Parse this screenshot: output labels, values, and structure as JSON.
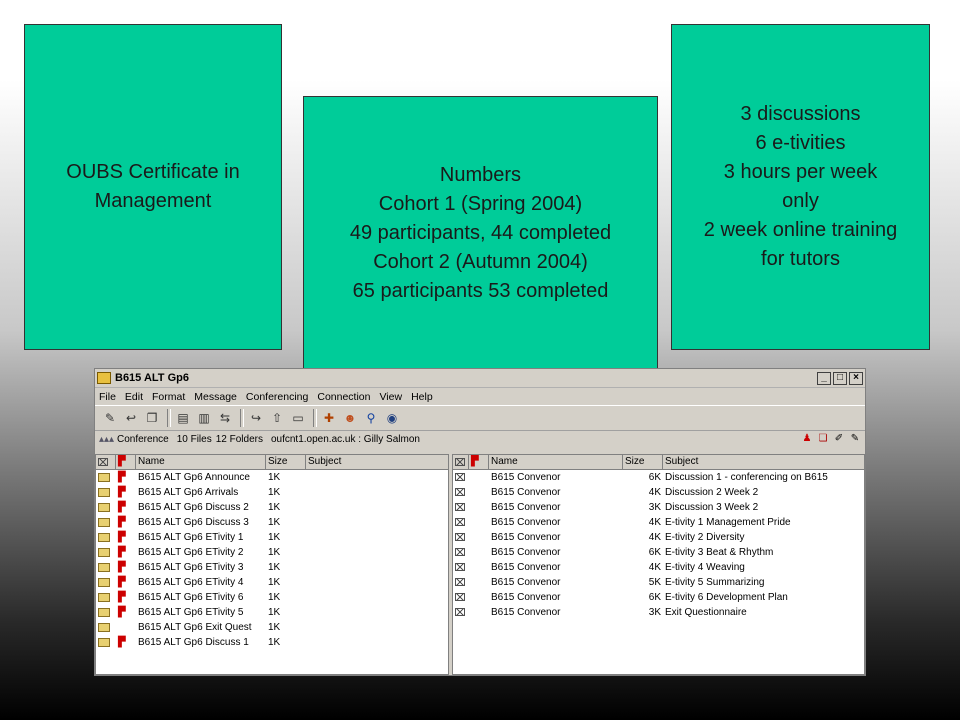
{
  "slide": {
    "box1": {
      "lines": [
        "OUBS Certificate in",
        "Management"
      ]
    },
    "box2": {
      "lines": [
        "Numbers",
        "Cohort 1 (Spring 2004)",
        "49 participants, 44 completed",
        "Cohort 2 (Autumn 2004)",
        "65 participants 53 completed"
      ]
    },
    "box3": {
      "lines": [
        "3 discussions",
        "6 e-tivities",
        "3 hours per week",
        "only",
        "2 week online training",
        "for tutors"
      ]
    }
  },
  "window": {
    "title": "B615 ALT Gp6",
    "min_label": "_",
    "max_label": "□",
    "close_label": "×",
    "menu": [
      "File",
      "Edit",
      "Format",
      "Message",
      "Conferencing",
      "Connection",
      "View",
      "Help"
    ],
    "toolbar_icons": [
      "compose-icon",
      "reply-icon",
      "copy-icon",
      "save-icon",
      "delete-icon",
      "move-icon",
      "forward-icon",
      "folder-icon",
      "participants-icon",
      "search-icon",
      "connect-icon"
    ],
    "info": {
      "conference_label": "Conference",
      "files": "10 Files",
      "folders": "12 Folders",
      "server": "oufcnt1.open.ac.uk : Gilly Salmon"
    },
    "left_pane": {
      "headers": {
        "name": "Name",
        "size": "Size",
        "subject": "Subject"
      },
      "rows": [
        {
          "name": "B615 ALT Gp6 Announce",
          "size": "1K",
          "flag": true
        },
        {
          "name": "B615 ALT Gp6 Arrivals",
          "size": "1K",
          "flag": true
        },
        {
          "name": "B615 ALT Gp6 Discuss 2",
          "size": "1K",
          "flag": true
        },
        {
          "name": "B615 ALT Gp6 Discuss 3",
          "size": "1K",
          "flag": true
        },
        {
          "name": "B615 ALT Gp6 ETivity 1",
          "size": "1K",
          "flag": true
        },
        {
          "name": "B615 ALT Gp6 ETivity 2",
          "size": "1K",
          "flag": true
        },
        {
          "name": "B615 ALT Gp6 ETivity 3",
          "size": "1K",
          "flag": true
        },
        {
          "name": "B615 ALT Gp6 ETivity 4",
          "size": "1K",
          "flag": true
        },
        {
          "name": "B615 ALT Gp6 ETivity 6",
          "size": "1K",
          "flag": true
        },
        {
          "name": "B615 ALT Gp6 ETivity 5",
          "size": "1K",
          "flag": true
        },
        {
          "name": "B615 ALT Gp6 Exit Quest",
          "size": "1K",
          "flag": false
        },
        {
          "name": "B615 ALT Gp6 Discuss 1",
          "size": "1K",
          "flag": true
        }
      ]
    },
    "right_pane": {
      "headers": {
        "name": "Name",
        "size": "Size",
        "subject": "Subject"
      },
      "rows": [
        {
          "name": "B615 Convenor",
          "size": "6K",
          "subject": "Discussion 1 - conferencing on B615"
        },
        {
          "name": "B615 Convenor",
          "size": "4K",
          "subject": "Discussion 2 Week 2"
        },
        {
          "name": "B615 Convenor",
          "size": "3K",
          "subject": "Discussion 3 Week 2"
        },
        {
          "name": "B615 Convenor",
          "size": "4K",
          "subject": "E-tivity 1 Management Pride"
        },
        {
          "name": "B615 Convenor",
          "size": "4K",
          "subject": "E-tivity 2 Diversity"
        },
        {
          "name": "B615 Convenor",
          "size": "6K",
          "subject": "E-tivity 3 Beat & Rhythm"
        },
        {
          "name": "B615 Convenor",
          "size": "4K",
          "subject": "E-tivity 4 Weaving"
        },
        {
          "name": "B615 Convenor",
          "size": "5K",
          "subject": "E-tivity 5 Summarizing"
        },
        {
          "name": "B615 Convenor",
          "size": "6K",
          "subject": "E-tivity 6 Development Plan"
        },
        {
          "name": "B615 Convenor",
          "size": "3K",
          "subject": "Exit Questionnaire"
        }
      ]
    }
  }
}
